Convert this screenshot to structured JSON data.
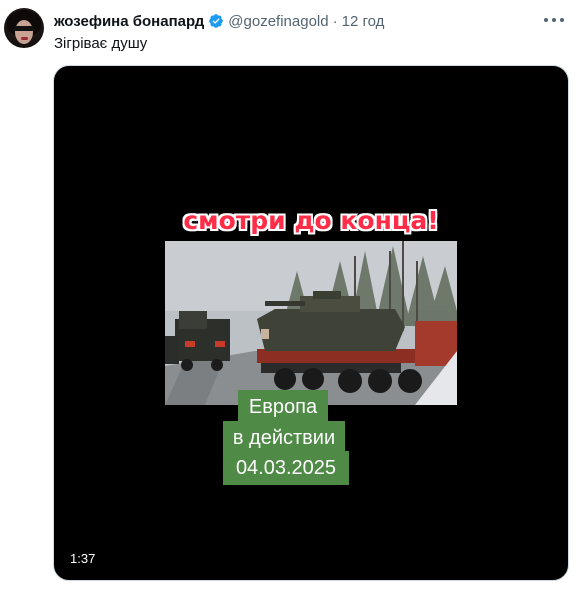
{
  "post": {
    "author_name": "жозефина бонапард",
    "handle": "@gozefinagold",
    "separator": "·",
    "time": "12 год",
    "text": "Зігріває душу"
  },
  "video": {
    "overlay_title": "смотри до конца!",
    "caption_line1": "Европа",
    "caption_line2": "в действии",
    "caption_line3": "04.03.2025",
    "duration": "1:37"
  },
  "icons": {
    "verified": "verified-badge-icon",
    "more": "more-options-icon"
  },
  "colors": {
    "verified_blue": "#1d9bf0",
    "overlay_red": "#ff2d47",
    "caption_green": "#4f8a46"
  }
}
